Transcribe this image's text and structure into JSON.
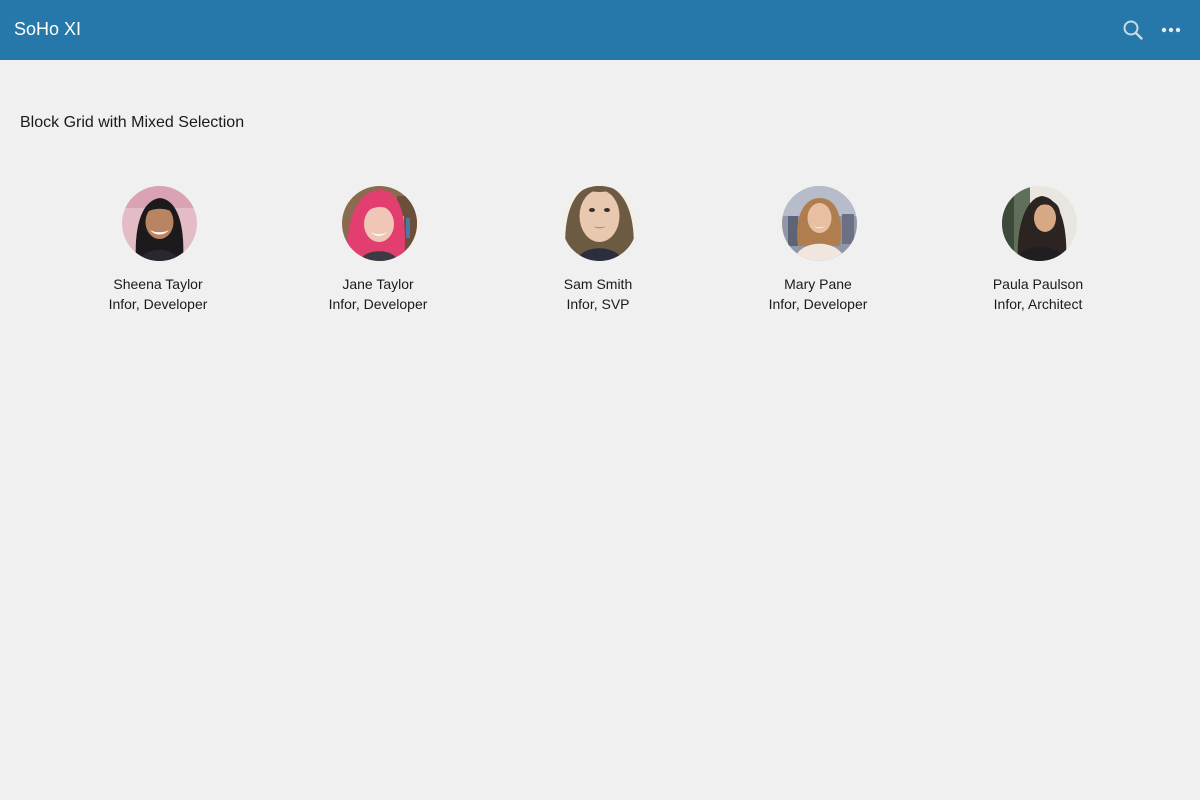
{
  "header": {
    "app_title": "SoHo XI",
    "background_color": "#2578a9",
    "actions": [
      {
        "icon": "search-icon"
      },
      {
        "icon": "more-horizontal-icon"
      }
    ]
  },
  "main": {
    "section_title": "Block Grid with Mixed Selection",
    "people": [
      {
        "name": "Sheena Taylor",
        "role": "Infor, Developer",
        "avatar": "avatar-photo"
      },
      {
        "name": "Jane Taylor",
        "role": "Infor, Developer",
        "avatar": "avatar-photo"
      },
      {
        "name": "Sam Smith",
        "role": "Infor, SVP",
        "avatar": "avatar-photo"
      },
      {
        "name": "Mary Pane",
        "role": "Infor, Developer",
        "avatar": "avatar-photo"
      },
      {
        "name": "Paula Paulson",
        "role": "Infor, Architect",
        "avatar": "avatar-photo"
      }
    ]
  }
}
